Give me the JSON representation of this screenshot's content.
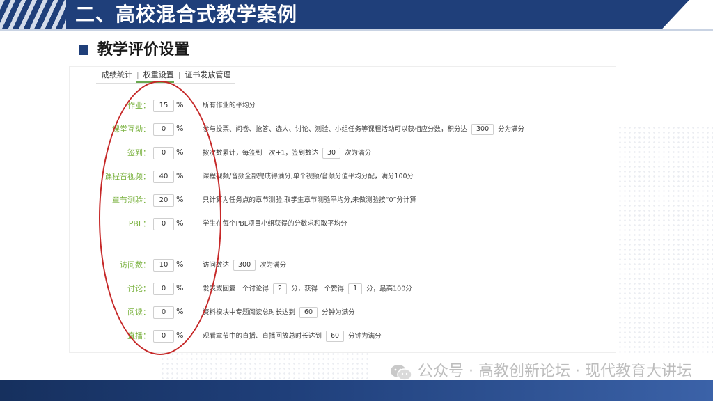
{
  "banner": {
    "title": "二、高校混合式教学案例"
  },
  "section": {
    "title": "教学评价设置"
  },
  "tabs": [
    {
      "label": "成绩统计"
    },
    {
      "label": "权重设置"
    },
    {
      "label": "证书发放管理"
    }
  ],
  "tab_separator": "|",
  "percent_sign": "%",
  "rows": [
    {
      "label": "作业：",
      "value": "15",
      "desc_parts": [
        "所有作业的平均分"
      ]
    },
    {
      "label": "课堂互动：",
      "value": "0",
      "desc_parts": [
        "参与投票、问卷、抢答、选人、讨论、测验、小组任务等课程活动可以获相应分数，积分达",
        "300",
        "分为满分"
      ]
    },
    {
      "label": "签到：",
      "value": "0",
      "desc_parts": [
        "按次数累计，每签到一次+1，签到数达",
        "30",
        "次为满分"
      ]
    },
    {
      "label": "课程音视频：",
      "value": "40",
      "desc_parts": [
        "课程视频/音频全部完成得满分,单个视频/音频分值平均分配，满分100分"
      ]
    },
    {
      "label": "章节测验：",
      "value": "20",
      "desc_parts": [
        "只计算为任务点的章节测验,取学生章节测验平均分,未做测验按“0”分计算"
      ]
    },
    {
      "label": "PBL：",
      "value": "0",
      "desc_parts": [
        "学生在每个PBL项目小组获得的分数求和取平均分"
      ]
    },
    {
      "label": "访问数：",
      "value": "10",
      "desc_parts": [
        "访问数达",
        "300",
        "次为满分"
      ]
    },
    {
      "label": "讨论：",
      "value": "0",
      "desc_parts": [
        "发表或回复一个讨论得",
        "2",
        "分，获得一个赞得",
        "1",
        "分，最高100分"
      ]
    },
    {
      "label": "阅读：",
      "value": "0",
      "desc_parts": [
        "资料模块中专题阅读总时长达到",
        "60",
        "分钟为满分"
      ]
    },
    {
      "label": "直播：",
      "value": "0",
      "desc_parts": [
        "观看章节中的直播、直播回放总时长达到",
        "60",
        "分钟为满分"
      ]
    }
  ],
  "watermark": {
    "text": "公众号 · 高教创新论坛 · 现代教育大讲坛"
  },
  "colors": {
    "banner": "#1f3f7a",
    "label_green": "#7cb342",
    "highlight_red": "#c62828"
  }
}
